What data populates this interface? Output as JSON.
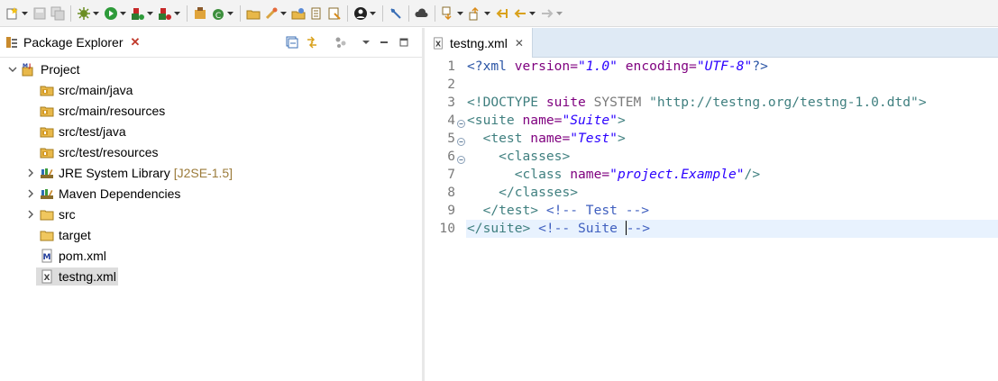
{
  "toolbar": {
    "icons": [
      "new-icon",
      "save-icon",
      "save-all-icon",
      "skip-icon",
      "debug-icon",
      "run-icon",
      "run-coverage-icon",
      "external-tools-icon",
      "new-java-project-icon",
      "new-class-icon",
      "open-type-icon",
      "search-icon",
      "open-task-icon",
      "open-perspective-icon",
      "annotation-icon",
      "profile-icon",
      "toggle-breadcrumb-icon",
      "cloud-icon",
      "next-annotation-icon",
      "previous-annotation-icon",
      "last-edit-icon",
      "back-icon",
      "forward-icon"
    ]
  },
  "explorer": {
    "title": "Package Explorer",
    "tree": [
      {
        "label": "Project",
        "icon": "maven-project-icon",
        "expanded": true
      },
      {
        "label": "src/main/java",
        "icon": "source-folder-icon"
      },
      {
        "label": "src/main/resources",
        "icon": "source-folder-icon"
      },
      {
        "label": "src/test/java",
        "icon": "source-folder-icon"
      },
      {
        "label": "src/test/resources",
        "icon": "source-folder-icon"
      },
      {
        "label": "JRE System Library",
        "decoration": "[J2SE-1.5]",
        "icon": "library-icon",
        "expanded": false
      },
      {
        "label": "Maven Dependencies",
        "icon": "library-icon",
        "expanded": false
      },
      {
        "label": "src",
        "icon": "folder-icon",
        "expanded": false
      },
      {
        "label": "target",
        "icon": "folder-icon"
      },
      {
        "label": "pom.xml",
        "icon": "maven-file-icon"
      },
      {
        "label": "testng.xml",
        "icon": "xml-file-icon",
        "selected": true
      }
    ]
  },
  "editor": {
    "tab_title": "testng.xml",
    "current_line": 10,
    "lines": [
      {
        "n": "1",
        "tokens": [
          [
            "pi",
            "<?xml "
          ],
          [
            "attr",
            "version="
          ],
          [
            "val",
            "\"1.0\""
          ],
          [
            "plain",
            " "
          ],
          [
            "attr",
            "encoding="
          ],
          [
            "val",
            "\"UTF-8\""
          ],
          [
            "pi",
            "?>"
          ]
        ]
      },
      {
        "n": "2",
        "tokens": []
      },
      {
        "n": "3",
        "tokens": [
          [
            "dt",
            "<!DOCTYPE "
          ],
          [
            "dt2",
            "suite "
          ],
          [
            "sys",
            "SYSTEM "
          ],
          [
            "str",
            "\"http://testng.org/testng-1.0.dtd\""
          ],
          [
            "dt",
            ">"
          ]
        ]
      },
      {
        "n": "4",
        "tokens": [
          [
            "tag",
            "<suite "
          ],
          [
            "attr",
            "name="
          ],
          [
            "val",
            "\"Suite\""
          ],
          [
            "tag",
            ">"
          ]
        ]
      },
      {
        "n": "5",
        "tokens": [
          [
            "plain",
            "  "
          ],
          [
            "tag",
            "<test "
          ],
          [
            "attr",
            "name="
          ],
          [
            "val",
            "\"Test\""
          ],
          [
            "tag",
            ">"
          ]
        ]
      },
      {
        "n": "6",
        "tokens": [
          [
            "plain",
            "    "
          ],
          [
            "tag",
            "<classes>"
          ]
        ]
      },
      {
        "n": "7",
        "tokens": [
          [
            "plain",
            "      "
          ],
          [
            "tag",
            "<class "
          ],
          [
            "attr",
            "name="
          ],
          [
            "val",
            "\"project.Example\""
          ],
          [
            "tag",
            "/>"
          ]
        ]
      },
      {
        "n": "8",
        "tokens": [
          [
            "plain",
            "    "
          ],
          [
            "tag",
            "</classes>"
          ]
        ]
      },
      {
        "n": "9",
        "tokens": [
          [
            "plain",
            "  "
          ],
          [
            "tag",
            "</test> "
          ],
          [
            "com",
            "<!-- Test -->"
          ]
        ]
      },
      {
        "n": "10",
        "tokens": [
          [
            "tag",
            "</suite> "
          ],
          [
            "com",
            "<!-- Suite "
          ],
          [
            "caret",
            ""
          ],
          [
            "com",
            "-->"
          ]
        ]
      }
    ],
    "fold_lines": [
      "4",
      "5",
      "6"
    ]
  }
}
